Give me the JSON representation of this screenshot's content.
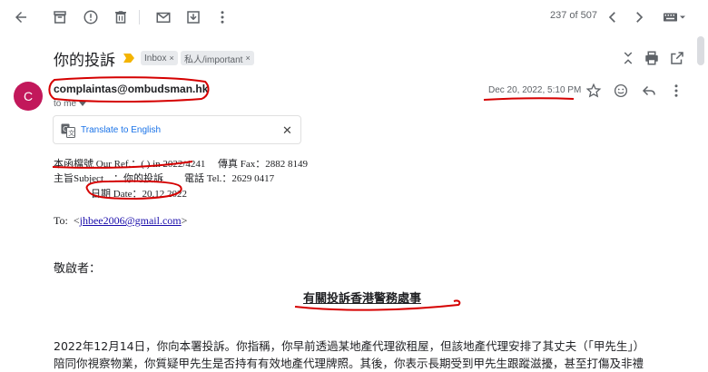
{
  "toolbar": {
    "counter": "237 of 507",
    "icons": [
      "back-arrow-icon",
      "archive-icon",
      "report-spam-icon",
      "delete-icon",
      "mark-unread-icon",
      "move-to-icon",
      "newer-icon",
      "older-icon",
      "keyboard-icon"
    ]
  },
  "subject": {
    "title": "你的投訴",
    "labels": [
      "Inbox",
      "私人/important"
    ]
  },
  "message": {
    "avatar_letter": "C",
    "sender": "complaintas@ombudsman.hk",
    "to_me": "to me",
    "date": "Dec 20, 2022, 5:10 PM"
  },
  "translate": {
    "label": "Translate to English"
  },
  "letter": {
    "ref_line": "本函檔號 Our Ref.：( ) in 2022/4241",
    "fax_line": "傳真 Fax：2882 8149",
    "subject_line": "主旨Subject　：你的投訴",
    "tel_line": "電話 Tel.：2629 0417",
    "date_line": "日期 Date：20.12.2022",
    "to_label": "To:",
    "to_email": "jhbee2006@gmail.com",
    "greeting": "敬啟者：",
    "heading": "有關投訴香港警務處事",
    "para1": "2022年12月14日，你向本署投訴。你指稱，你早前透過某地產代理欲租屋，但該地產代理安排了其丈夫（「甲先生」）",
    "para2": "陪同你視察物業，你質疑甲先生是否持有有效地產代理牌照。其後，你表示長期受到甲先生跟蹤滋擾，甚至打傷及非禮"
  },
  "colors": {
    "avatar": "#c2185b",
    "annotation": "#d50000",
    "link": "#1a0dab",
    "important_marker": "#f4b400"
  }
}
